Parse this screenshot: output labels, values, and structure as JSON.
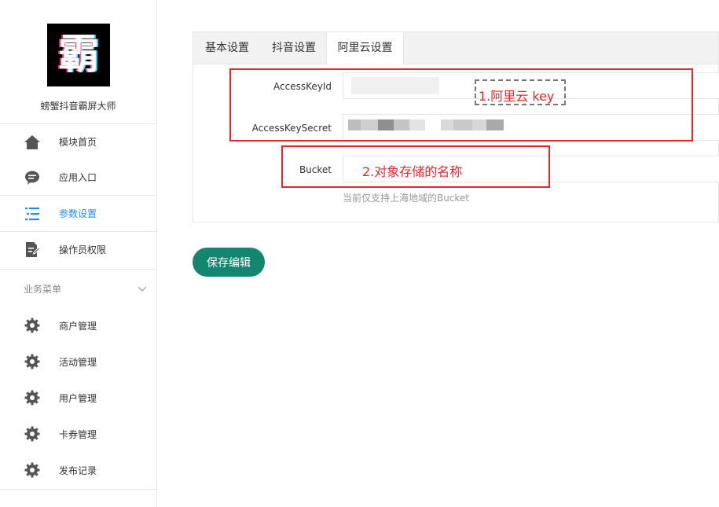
{
  "app": {
    "logo_char": "霸",
    "name": "螃蟹抖音霸屏大师"
  },
  "nav": {
    "items": [
      {
        "label": "模块首页",
        "icon": "home-icon"
      },
      {
        "label": "应用入口",
        "icon": "chat-bubble-icon"
      },
      {
        "label": "参数设置",
        "icon": "settings-list-icon",
        "active": true
      },
      {
        "label": "操作员权限",
        "icon": "document-edit-icon"
      }
    ],
    "section": {
      "label": "业务菜单"
    },
    "sub_items": [
      {
        "label": "商户管理",
        "icon": "gear-icon"
      },
      {
        "label": "活动管理",
        "icon": "gear-icon"
      },
      {
        "label": "用户管理",
        "icon": "gear-icon"
      },
      {
        "label": "卡券管理",
        "icon": "gear-icon"
      },
      {
        "label": "发布记录",
        "icon": "gear-icon"
      }
    ]
  },
  "tabs": [
    "基本设置",
    "抖音设置",
    "阿里云设置"
  ],
  "form": {
    "access_key_id_label": "AccessKeyId",
    "access_key_secret_label": "AccessKeySecret",
    "bucket_label": "Bucket",
    "bucket_hint": "当前仅支持上海地域的Bucket"
  },
  "save_label": "保存编辑",
  "annotations": {
    "note1": "1.阿里云 key",
    "note2": "2.对象存储的名称"
  },
  "colors": {
    "accent": "#1f8cff",
    "button": "#14866f",
    "annotation": "#e8262c"
  }
}
